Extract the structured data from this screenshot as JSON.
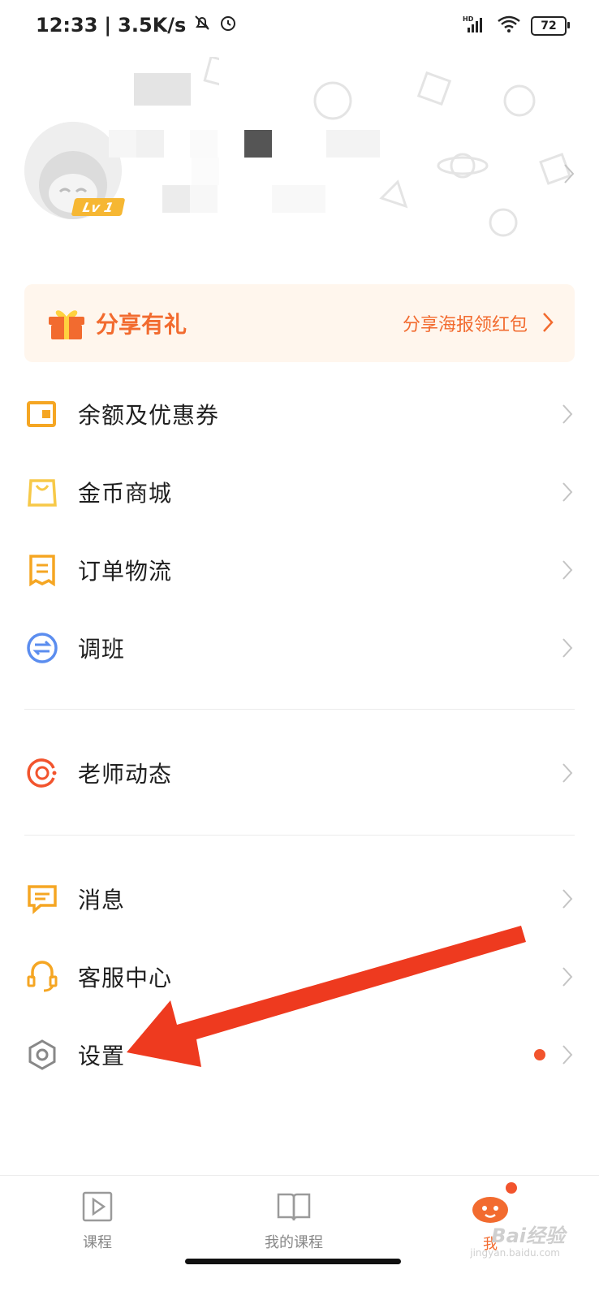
{
  "status_bar": {
    "time": "12:33",
    "net_speed": "3.5K/s",
    "battery": "72",
    "signal_label": "HD"
  },
  "profile": {
    "level": "Lv 1"
  },
  "share": {
    "title": "分享有礼",
    "link": "分享海报领红包"
  },
  "menu": {
    "balance": "余额及优惠券",
    "mall": "金币商城",
    "orders": "订单物流",
    "transfer": "调班",
    "teacher": "老师动态",
    "messages": "消息",
    "service": "客服中心",
    "settings": "设置"
  },
  "tabs": {
    "course": "课程",
    "my_course": "我的课程",
    "me": "我"
  },
  "watermark": {
    "brand": "Bai经验",
    "url": "jingyan.baidu.com"
  },
  "colors": {
    "accent": "#f26b2f",
    "banner_bg": "#fff6ed",
    "notify_dot": "#f2542d",
    "icon_orange": "#f5a623",
    "icon_blue": "#5b8def",
    "arrow": "#ee3a1f"
  }
}
